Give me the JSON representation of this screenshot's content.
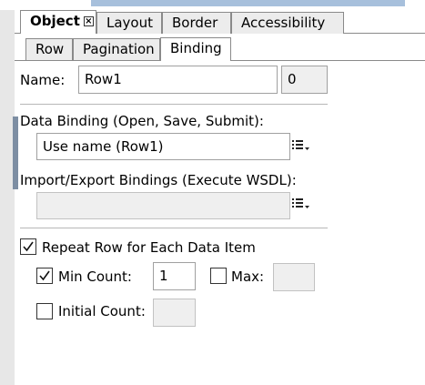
{
  "tabs": {
    "main": [
      {
        "label": "Object",
        "active": true
      },
      {
        "label": "Layout",
        "active": false
      },
      {
        "label": "Border",
        "active": false
      },
      {
        "label": "Accessibility",
        "active": false
      }
    ],
    "sub": [
      {
        "label": "Row",
        "active": false
      },
      {
        "label": "Pagination",
        "active": false
      },
      {
        "label": "Binding",
        "active": true
      }
    ]
  },
  "name": {
    "label": "Name:",
    "value": "Row1",
    "index": "0"
  },
  "data_binding": {
    "label": "Data Binding (Open, Save, Submit):",
    "value": "Use name (Row1)"
  },
  "import_export": {
    "label": "Import/Export Bindings (Execute WSDL):",
    "value": ""
  },
  "repeat": {
    "label": "Repeat Row for Each Data Item",
    "checked": true,
    "min_count": {
      "label": "Min Count:",
      "checked": true,
      "value": "1"
    },
    "max": {
      "label": "Max:",
      "checked": false,
      "value": ""
    },
    "initial_count": {
      "label": "Initial Count:",
      "checked": false,
      "value": ""
    }
  },
  "icons": {
    "menu": "binding-menu-icon",
    "close": "close-icon",
    "check": "checkmark-icon"
  }
}
